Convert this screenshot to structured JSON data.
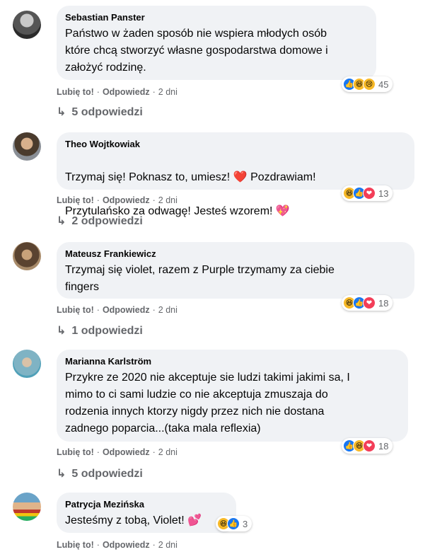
{
  "actions": {
    "like": "Lubię to!",
    "reply": "Odpowiedz",
    "sep": "·"
  },
  "comments": [
    {
      "author": "Sebastian Panster",
      "text": "Państwo w żaden sposób nie wspiera młodych osób\nktóre chcą stworzyć własne gospodarstwa domowe i\nzałożyć rodzinę.",
      "time": "2 dni",
      "reactions": [
        "like",
        "haha",
        "sad"
      ],
      "reaction_count": "45",
      "replies": "5 odpowiedzi"
    },
    {
      "author": "Theo Wojtkowiak",
      "text_part1": "Trzymaj się! Poknasz to, umiesz!",
      "text_part2": "Pozdrawiam!",
      "text_line2": "Przytulańsko za odwagę! Jesteś wzorem!",
      "time": "2 dni",
      "reactions": [
        "haha",
        "like",
        "love"
      ],
      "reaction_count": "13",
      "replies": "2 odpowiedzi"
    },
    {
      "author": "Mateusz Frankiewicz",
      "text": "Trzymaj się violet, razem z Purple trzymamy za ciebie\nfingers",
      "time": "2 dni",
      "reactions": [
        "haha",
        "like",
        "love"
      ],
      "reaction_count": "18",
      "replies": "1 odpowiedzi"
    },
    {
      "author": "Marianna Karlström",
      "text": "Przykre ze 2020 nie akceptuje sie ludzi takimi jakimi sa, I\nmimo to ci sami ludzie co nie akceptuja zmuszaja do\nrodzenia innych ktorzy nigdy przez nich nie dostana\nzadnego poparcia...(taka mala reflexia)",
      "time": "2 dni",
      "reactions": [
        "like",
        "haha",
        "love"
      ],
      "reaction_count": "18",
      "replies": "5 odpowiedzi"
    },
    {
      "author": "Patrycja Mezińska",
      "text": "Jesteśmy z tobą, Violet!",
      "time": "2 dni",
      "reactions": [
        "haha",
        "like"
      ],
      "reaction_count": "3"
    }
  ],
  "icons": {
    "reply_arrow": "↳",
    "like": "👍",
    "haha": "😆",
    "sad": "😢",
    "love": "❤",
    "heart": "❤️",
    "sparkle_heart": "💖",
    "hearts": "💕"
  }
}
